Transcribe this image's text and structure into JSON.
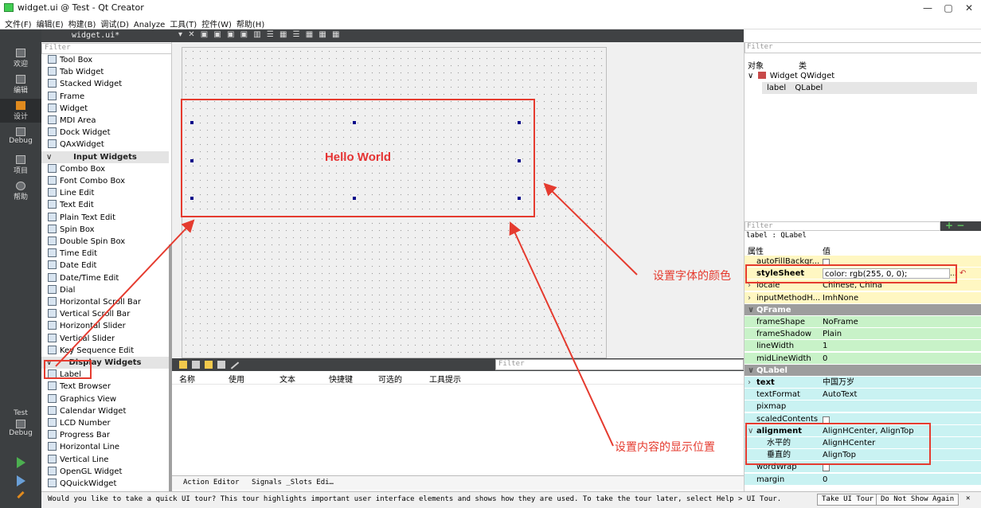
{
  "window": {
    "title": "widget.ui @ Test - Qt Creator",
    "minimize": "—",
    "maximize": "▢",
    "close": "✕"
  },
  "menu": [
    "文件(F)",
    "编辑(E)",
    "构建(B)",
    "调试(D)",
    "Analyze",
    "工具(T)",
    "控件(W)",
    "帮助(H)"
  ],
  "modes": [
    "欢迎",
    "编辑",
    "设计",
    "Debug",
    "项目",
    "帮助"
  ],
  "kit": {
    "project": "Test",
    "config": "Debug"
  },
  "widgetbox": {
    "tab": "widget.ui*",
    "filter_placeholder": "Filter",
    "items_top": [
      "Tool Box",
      "Tab Widget",
      "Stacked Widget",
      "Frame",
      "Widget",
      "MDI Area",
      "Dock Widget",
      "QAxWidget"
    ],
    "cat_input": "Input Widgets",
    "items_input": [
      "Combo Box",
      "Font Combo Box",
      "Line Edit",
      "Text Edit",
      "Plain Text Edit",
      "Spin Box",
      "Double Spin Box",
      "Time Edit",
      "Date Edit",
      "Date/Time Edit",
      "Dial",
      "Horizontal Scroll Bar",
      "Vertical Scroll Bar",
      "Horizontal Slider",
      "Vertical Slider",
      "Key Sequence Edit"
    ],
    "cat_display": "Display Widgets",
    "items_display": [
      "Label",
      "Text Browser",
      "Graphics View",
      "Calendar Widget",
      "LCD Number",
      "Progress Bar",
      "Horizontal Line",
      "Vertical Line",
      "OpenGL Widget",
      "QQuickWidget"
    ]
  },
  "form": {
    "label_text": "Hello World"
  },
  "action_editor": {
    "filter_placeholder": "Filter",
    "columns": [
      "名称",
      "使用",
      "文本",
      "快捷键",
      "可选的",
      "工具提示"
    ],
    "tabs": [
      "Action Editor",
      "Signals _Slots Edi…"
    ]
  },
  "object_inspector": {
    "filter_placeholder": "Filter",
    "col_object": "对象",
    "col_class": "类",
    "rows": [
      {
        "name": "Widget",
        "cls": "QWidget"
      },
      {
        "name": "label",
        "cls": "QLabel"
      }
    ]
  },
  "property_editor": {
    "filter_placeholder": "Filter",
    "class_line": "label : QLabel",
    "col_prop": "属性",
    "col_value": "值",
    "rows": [
      {
        "name": "autoFillBackgr...",
        "value": ""
      },
      {
        "name": "styleSheet",
        "value": "color: rgb(255, 0, 0);"
      },
      {
        "name": "locale",
        "value": "Chinese, China"
      },
      {
        "name": "inputMethodH...",
        "value": "ImhNone"
      },
      {
        "name": "QFrame",
        "value": ""
      },
      {
        "name": "frameShape",
        "value": "NoFrame"
      },
      {
        "name": "frameShadow",
        "value": "Plain"
      },
      {
        "name": "lineWidth",
        "value": "1"
      },
      {
        "name": "midLineWidth",
        "value": "0"
      },
      {
        "name": "QLabel",
        "value": ""
      },
      {
        "name": "text",
        "value": "中国万岁"
      },
      {
        "name": "textFormat",
        "value": "AutoText"
      },
      {
        "name": "pixmap",
        "value": ""
      },
      {
        "name": "scaledContents",
        "value": ""
      },
      {
        "name": "alignment",
        "value": "AlignHCenter, AlignTop"
      },
      {
        "name": "水平的",
        "value": "AlignHCenter"
      },
      {
        "name": "垂直的",
        "value": "AlignTop"
      },
      {
        "name": "wordWrap",
        "value": ""
      },
      {
        "name": "margin",
        "value": "0"
      }
    ],
    "more_button": "...",
    "reset_button": "↶"
  },
  "annotations": {
    "color_note": "设置字体的颜色",
    "align_note": "设置内容的显示位置"
  },
  "statusbar": {
    "message": "Would you like to take a quick UI tour? This tour highlights important user interface elements and shows how they are used. To take the tour later, select Help > UI Tour.",
    "take_tour": "Take UI Tour",
    "dont_show": "Do Not Show Again",
    "close": "✕"
  },
  "colors": {
    "annotation": "#e53b2f",
    "label_text": "#e53333",
    "panel_dark": "#404244",
    "mode_bar": "#3c3f41"
  }
}
